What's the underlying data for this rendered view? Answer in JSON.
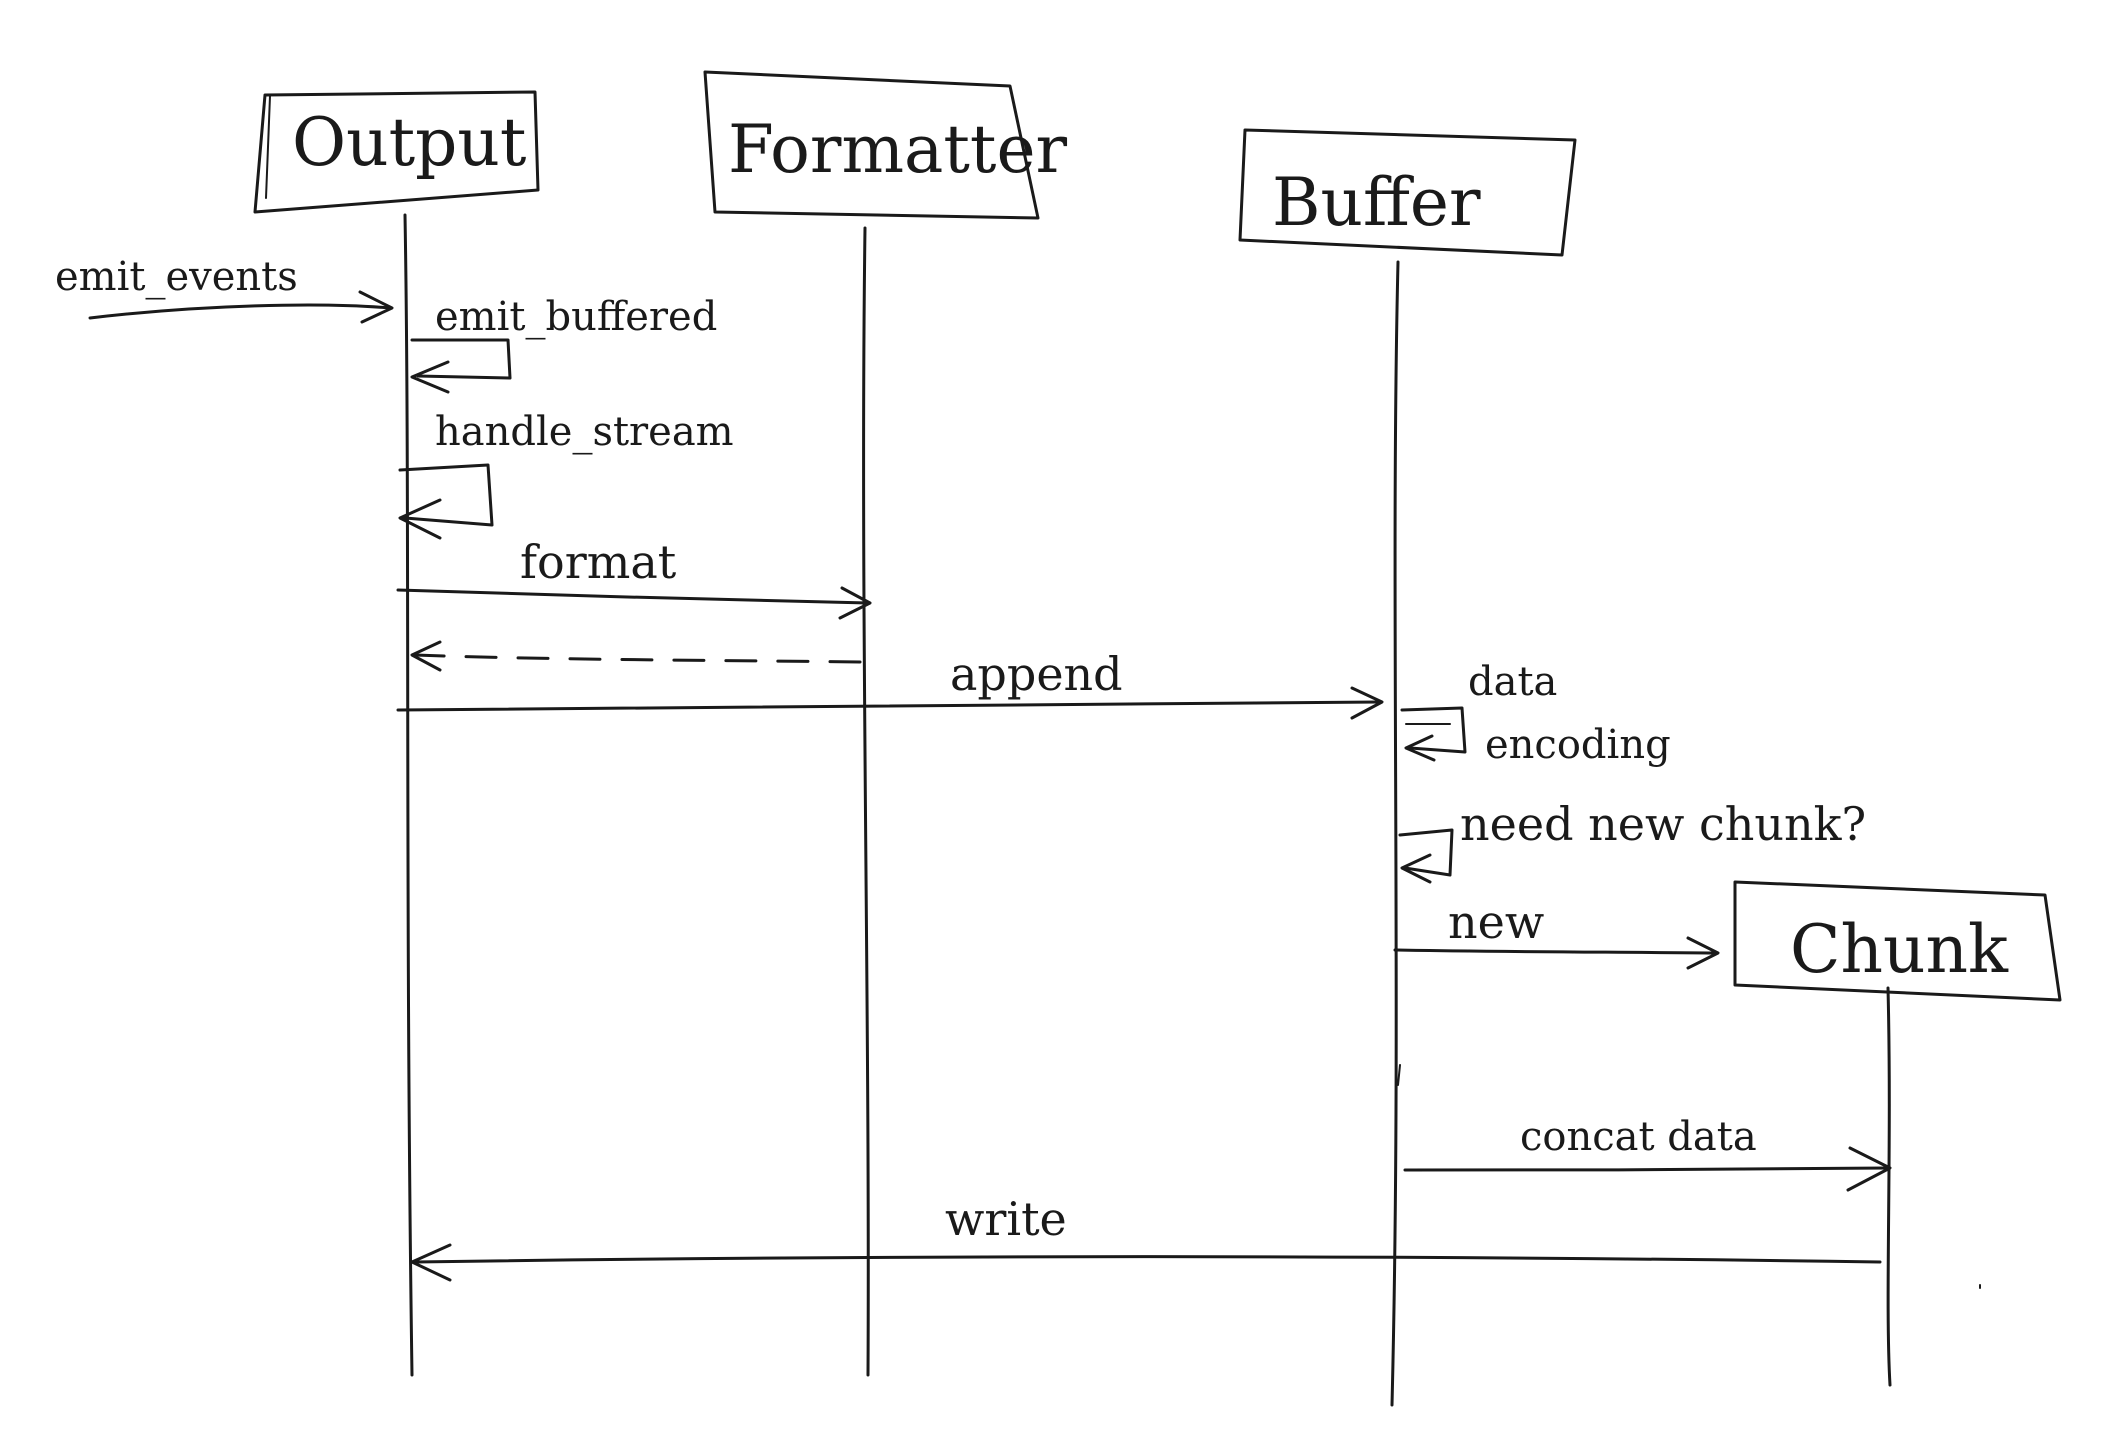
{
  "participants": {
    "output": "Output",
    "formatter": "Formatter",
    "buffer": "Buffer",
    "chunk": "Chunk"
  },
  "messages": {
    "emit_events": "emit_events",
    "emit_buffered": "emit_buffered",
    "handle_stream": "handle_stream",
    "format": "format",
    "append": "append",
    "data": "data",
    "encoding": "encoding",
    "need_new_chunk": "need new chunk?",
    "new": "new",
    "concat_data": "concat data",
    "write": "write"
  }
}
